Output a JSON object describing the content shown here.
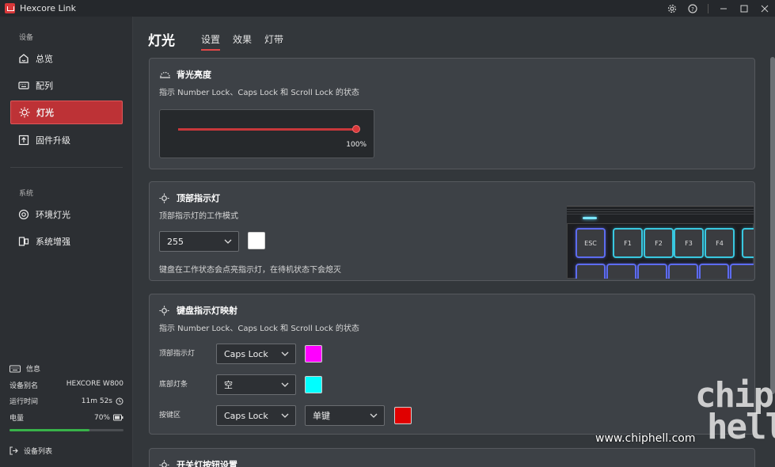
{
  "app": {
    "title": "Hexcore Link"
  },
  "sidebar": {
    "section_devices": "设备",
    "items": [
      {
        "label": "总览",
        "icon": "home-icon"
      },
      {
        "label": "配列",
        "icon": "keyboard-icon"
      },
      {
        "label": "灯光",
        "icon": "light-icon",
        "active": true
      },
      {
        "label": "固件升级",
        "icon": "upload-icon"
      }
    ],
    "section_system": "系统",
    "system_items": [
      {
        "label": "环境灯光",
        "icon": "ambient-light-icon"
      },
      {
        "label": "系统增强",
        "icon": "system-enhance-icon"
      }
    ],
    "info": {
      "title": "信息",
      "alias_label": "设备别名",
      "alias_value": "HEXCORE W800",
      "uptime_label": "运行时间",
      "uptime_value": "11m 52s",
      "battery_label": "电量",
      "battery_value": "70%",
      "battery_fraction": 0.7
    },
    "device_list": "设备列表"
  },
  "page": {
    "title": "灯光",
    "tabs": [
      "设置",
      "效果",
      "灯带"
    ],
    "active_tab": 0
  },
  "backlight": {
    "title": "背光亮度",
    "desc": "指示 Number Lock、Caps Lock 和 Scroll Lock 的状态",
    "value": "100%"
  },
  "top_indicator": {
    "title": "顶部指示灯",
    "desc": "顶部指示灯的工作模式",
    "select_value": "255",
    "swatch_color": "#ffffff",
    "note": "键盘在工作状态会点亮指示灯，在待机状态下会熄灭",
    "keys": [
      "ESC",
      "F1",
      "F2",
      "F3",
      "F4"
    ]
  },
  "key_map": {
    "title": "键盘指示灯映射",
    "desc": "指示 Number Lock、Caps Lock 和 Scroll Lock 的状态",
    "rows": [
      {
        "label": "顶部指示灯",
        "select": "Caps Lock",
        "color": "#ff00ff"
      },
      {
        "label": "底部灯条",
        "select": "空",
        "color": "#00ffff"
      },
      {
        "label": "按键区",
        "select": "Caps Lock",
        "select2": "单键",
        "color": "#e00000"
      }
    ]
  },
  "switch_light": {
    "title": "开关灯按钮设置"
  },
  "watermark": {
    "logo_line1": "chip",
    "logo_line2": "hell",
    "url": "www.chiphell.com"
  },
  "colors": {
    "accent": "#d9383a",
    "battery": "#38b34a"
  }
}
